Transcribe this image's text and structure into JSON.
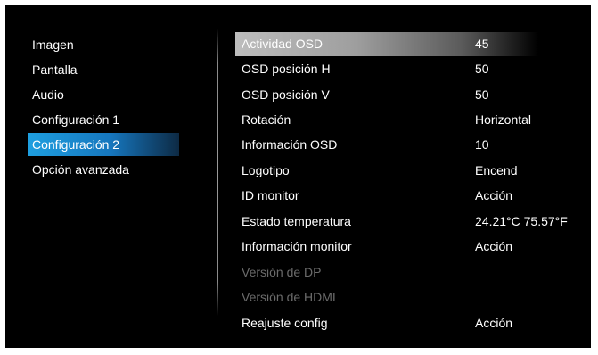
{
  "left_menu": {
    "items": [
      {
        "label": "Imagen"
      },
      {
        "label": "Pantalla"
      },
      {
        "label": "Audio"
      },
      {
        "label": "Configuración 1"
      },
      {
        "label": "Configuración 2",
        "selected": true
      },
      {
        "label": "Opción avanzada"
      }
    ]
  },
  "settings": {
    "rows": [
      {
        "label": "Actividad OSD",
        "value": "45",
        "highlighted": true
      },
      {
        "label": "OSD posición H",
        "value": "50"
      },
      {
        "label": "OSD posición V",
        "value": "50"
      },
      {
        "label": "Rotación",
        "value": "Horizontal"
      },
      {
        "label": "Información OSD",
        "value": "10"
      },
      {
        "label": "Logotipo",
        "value": "Encend"
      },
      {
        "label": "ID monitor",
        "value": "Acción"
      },
      {
        "label": "Estado temperatura",
        "value": "24.21°C 75.57°F"
      },
      {
        "label": "Información monitor",
        "value": "Acción"
      },
      {
        "label": "Versión de DP",
        "value": "",
        "disabled": true
      },
      {
        "label": "Versión de HDMI",
        "value": "",
        "disabled": true
      },
      {
        "label": "Reajuste config",
        "value": "Acción"
      }
    ]
  },
  "colors": {
    "background": "#000000",
    "accent_selected": "#1676bd",
    "text": "#ffffff",
    "text_disabled": "#6b6b6b"
  }
}
